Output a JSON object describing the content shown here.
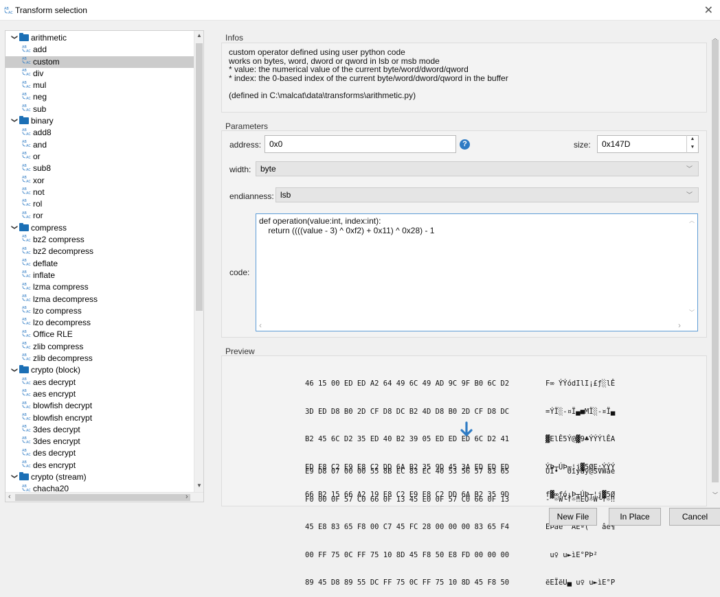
{
  "window": {
    "title": "Transform selection"
  },
  "tree": [
    {
      "type": "folder",
      "label": "arithmetic"
    },
    {
      "type": "leaf",
      "label": "add"
    },
    {
      "type": "leaf",
      "label": "custom",
      "selected": true
    },
    {
      "type": "leaf",
      "label": "div"
    },
    {
      "type": "leaf",
      "label": "mul"
    },
    {
      "type": "leaf",
      "label": "neg"
    },
    {
      "type": "leaf",
      "label": "sub"
    },
    {
      "type": "folder",
      "label": "binary"
    },
    {
      "type": "leaf",
      "label": "add8"
    },
    {
      "type": "leaf",
      "label": "and"
    },
    {
      "type": "leaf",
      "label": "or"
    },
    {
      "type": "leaf",
      "label": "sub8"
    },
    {
      "type": "leaf",
      "label": "xor"
    },
    {
      "type": "leaf",
      "label": "not"
    },
    {
      "type": "leaf",
      "label": "rol"
    },
    {
      "type": "leaf",
      "label": "ror"
    },
    {
      "type": "folder",
      "label": "compress"
    },
    {
      "type": "leaf",
      "label": "bz2 compress"
    },
    {
      "type": "leaf",
      "label": "bz2 decompress"
    },
    {
      "type": "leaf",
      "label": "deflate"
    },
    {
      "type": "leaf",
      "label": "inflate"
    },
    {
      "type": "leaf",
      "label": "lzma compress"
    },
    {
      "type": "leaf",
      "label": "lzma decompress"
    },
    {
      "type": "leaf",
      "label": "lzo compress"
    },
    {
      "type": "leaf",
      "label": "lzo decompress"
    },
    {
      "type": "leaf",
      "label": "Office RLE"
    },
    {
      "type": "leaf",
      "label": "zlib compress"
    },
    {
      "type": "leaf",
      "label": "zlib decompress"
    },
    {
      "type": "folder",
      "label": "crypto (block)"
    },
    {
      "type": "leaf",
      "label": "aes decrypt"
    },
    {
      "type": "leaf",
      "label": "aes encrypt"
    },
    {
      "type": "leaf",
      "label": "blowfish decrypt"
    },
    {
      "type": "leaf",
      "label": "blowfish encrypt"
    },
    {
      "type": "leaf",
      "label": "3des decrypt"
    },
    {
      "type": "leaf",
      "label": "3des encrypt"
    },
    {
      "type": "leaf",
      "label": "des decrypt"
    },
    {
      "type": "leaf",
      "label": "des encrypt"
    },
    {
      "type": "folder",
      "label": "crypto (stream)"
    },
    {
      "type": "leaf",
      "label": "chacha20"
    }
  ],
  "infos": {
    "title": "Infos",
    "lines": [
      "custom operator defined using user python code",
      "works on bytes, word, dword or qword in lsb or msb mode",
      "* value: the numerical value of the current byte/word/dword/qword",
      "* index: the 0-based index of the current byte/word/dword/qword in the buffer",
      "",
      "(defined in C:\\malcat\\data\\transforms\\arithmetic.py)"
    ]
  },
  "params": {
    "title": "Parameters",
    "address_label": "address:",
    "address_value": "0x0",
    "help_glyph": "?",
    "size_label": "size:",
    "size_value": "0x147D",
    "width_label": "width:",
    "width_value": "byte",
    "endianness_label": "endianness:",
    "endianness_value": "lsb",
    "code_label": "code:",
    "code": "def operation(value:int, index:int):\n    return ((((value - 3) ^ 0xf2) + 0x11) ^ 0x28) - 1"
  },
  "preview": {
    "title": "Preview",
    "input_hex": [
      "46 15 00 ED ED A2 64 49 6C 49 AD 9C 9F B0 6C D2",
      "3D ED D8 B0 2D CF D8 DC B2 4D D8 B0 2D CF D8 DC",
      "B2 45 6C D2 35 ED 40 B2 39 05 ED ED ED 6C D2 41",
      "ED E8 C2 E9 E8 C2 DD 6A B2 35 9D 45 3A ED ED ED",
      "66 B2 15 66 A2 19 E8 C2 E9 E8 C2 DD 6A B2 35 9D"
    ],
    "input_ascii": [
      "F∞ ÝÝódIlI¡£ƒ░lÊ",
      "=ÝÏ░-¤Ï▄■MÏ░-¤Ï▄",
      "▓ElÊ5Ý@▓9♣ÝÝÝlÊA",
      "ÝÞ┬ÚÞ┬¦j▓5ØE:ÝÝÝ",
      "f▓∞fó↓Þ┬ÚÞ┬¦j▓5Ø"
    ],
    "output_hex": [
      "E9 D8 07 00 00 55 8B EC 83 EC 40 53 56 57 83 65",
      "F0 00 0F 57 C0 66 0F 13 45 E0 0F 57 C0 66 0F 13",
      "45 E8 83 65 F8 00 C7 45 FC 28 00 00 00 83 65 F4",
      "00 FF 75 0C FF 75 10 8D 45 F8 50 E8 FD 00 00 00",
      "89 45 D8 89 55 DC FF 75 0C FF 75 10 8D 45 F8 50"
    ],
    "output_ascii": [
      "ÚÏ•  Uïýâÿ@SVWâe",
      "- ☼W└f☼‼EÓ☼W└f☼‼",
      "EÞâe° ÃEª(   âe¶",
      " u♀ u►ìE°PÞ²",
      "ëEÏëU▄ u♀ u►ìE°P"
    ]
  },
  "buttons": {
    "new_file": "New File",
    "in_place": "In Place",
    "cancel": "Cancel"
  },
  "colors": {
    "accent": "#2e7bc4",
    "folder": "#1b6fb5",
    "selection": "#cccccc"
  }
}
